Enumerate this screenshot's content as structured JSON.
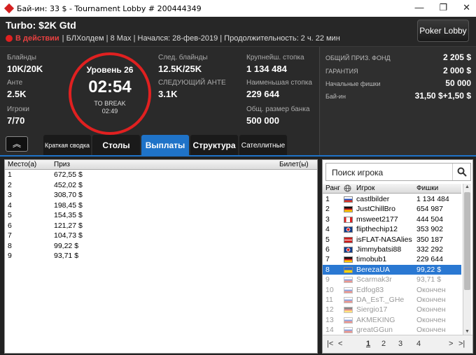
{
  "window": {
    "title": "Бай-ин: 33 $ - Tournament Lobby # 200444349",
    "minimize": "—",
    "restore": "❐",
    "close": "✕"
  },
  "header": {
    "game_title": "Turbo: $2K Gtd",
    "status": "В действии",
    "details": "| БЛХолдем | 8 Max | Начался: 28-фев-2019 | Продолжительность: 2 ч. 22 мин",
    "lobby_button": "Poker Lobby"
  },
  "stats": {
    "blinds_label": "Блайнды",
    "blinds_value": "10K/20K",
    "ante_label": "Анте",
    "ante_value": "2.5K",
    "players_label": "Игроки",
    "players_value": "7/70",
    "next_blinds_label": "След. блайнды",
    "next_blinds_value": "12.5K/25K",
    "next_ante_label": "СЛЕДУЮЩИЙ АНТЕ",
    "next_ante_value": "3.1K",
    "largest_stack_label": "Крупнейш. стопка",
    "largest_stack_value": "1 134 484",
    "smallest_stack_label": "Наименьшая стопка",
    "smallest_stack_value": "229 644",
    "bank_label": "Общ. размер банка",
    "bank_value": "500 000"
  },
  "clock": {
    "level": "Уровень 26",
    "time": "02:54",
    "to_break_label": "TO BREAK",
    "to_break_time": "02:49"
  },
  "prize_info": {
    "pool_label": "ОБЩИЙ ПРИЗ. ФОНД",
    "pool_value": "2 205 $",
    "guarantee_label": "ГАРАНТИЯ",
    "guarantee_value": "2 000 $",
    "chips_label": "Начальные фишки",
    "chips_value": "50 000",
    "buyin_label": "Бай-ин",
    "buyin_value": "31,50 $+1,50 $"
  },
  "tabs": [
    {
      "label": "Краткая сводка"
    },
    {
      "label": "Столы"
    },
    {
      "label": "Выплаты"
    },
    {
      "label": "Структура"
    },
    {
      "label": "Сателлитные"
    }
  ],
  "payouts": {
    "headers": {
      "place": "Место(а)",
      "prize": "Приз",
      "ticket": "Билет(ы)"
    },
    "rows": [
      {
        "place": "1",
        "prize": "672,55 $"
      },
      {
        "place": "2",
        "prize": "452,02 $"
      },
      {
        "place": "3",
        "prize": "308,70 $"
      },
      {
        "place": "4",
        "prize": "198,45 $"
      },
      {
        "place": "5",
        "prize": "154,35 $"
      },
      {
        "place": "6",
        "prize": "121,27 $"
      },
      {
        "place": "7",
        "prize": "104,73 $"
      },
      {
        "place": "8",
        "prize": "99,22 $"
      },
      {
        "place": "9",
        "prize": "93,71 $"
      }
    ]
  },
  "players": {
    "search_placeholder": "Поиск игрока",
    "headers": {
      "rank": "Ранг",
      "player": "Игрок",
      "chips": "Фишки"
    },
    "rows": [
      {
        "rank": "1",
        "name": "castlbilder",
        "chips": "1 134 484",
        "flag": "russia"
      },
      {
        "rank": "2",
        "name": "JustChillBro",
        "chips": "654 987",
        "flag": "germany"
      },
      {
        "rank": "3",
        "name": "msweet2177",
        "chips": "444 504",
        "flag": "canada"
      },
      {
        "rank": "4",
        "name": "flipthechip12",
        "chips": "353 902",
        "flag": "uk"
      },
      {
        "rank": "5",
        "name": "isFLAT-NASAlies",
        "chips": "350 187",
        "flag": "denmark"
      },
      {
        "rank": "6",
        "name": "Jimmybatsi88",
        "chips": "332 292",
        "flag": "uk"
      },
      {
        "rank": "7",
        "name": "timobub1",
        "chips": "229 644",
        "flag": "germany"
      },
      {
        "rank": "8",
        "name": "BerezaUA",
        "chips": "99,22 $",
        "flag": "ukraine"
      },
      {
        "rank": "9",
        "name": "Scarmak3r",
        "chips": "93,71 $",
        "flag": "russia"
      },
      {
        "rank": "10",
        "name": "Edfog83",
        "chips": "Окончен",
        "flag": "russia"
      },
      {
        "rank": "11",
        "name": "DA_EsT._GHe",
        "chips": "Окончен",
        "flag": "russia"
      },
      {
        "rank": "12",
        "name": "Siergio17",
        "chips": "Окончен",
        "flag": "germany"
      },
      {
        "rank": "13",
        "name": "AKMEKING",
        "chips": "Окончен",
        "flag": "russia"
      },
      {
        "rank": "14",
        "name": "greatGGun",
        "chips": "Окончен",
        "flag": "russia"
      }
    ],
    "pages": [
      "1",
      "2",
      "3",
      "4"
    ],
    "pager_first": "|<",
    "pager_prev": "<",
    "pager_next": ">",
    "pager_last": ">|"
  }
}
